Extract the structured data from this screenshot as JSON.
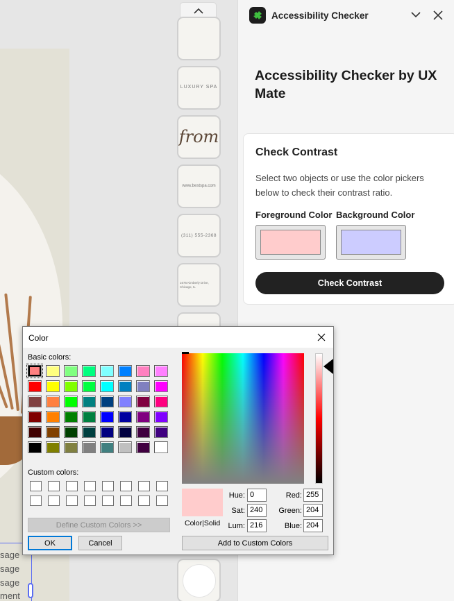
{
  "canvas": {
    "thumbnails": [
      "",
      "LUXURY SPA",
      "from",
      "www.bestspa.com",
      "(311) 555-2368",
      "1676 Kimberly Drive, Chicago, IL",
      "",
      ""
    ],
    "artboard_text": [
      "sage",
      "sage",
      "sage",
      "ment"
    ]
  },
  "panel": {
    "title": "Accessibility Checker",
    "heading": "Accessibility Checker by UX Mate",
    "card": {
      "title": "Check Contrast",
      "description": "Select two objects or use the color pickers below to check their contrast ratio.",
      "foreground_label": "Foreground Color",
      "background_label": "Background Color",
      "foreground_color": "#ffcccc",
      "background_color": "#ccccff",
      "button_label": "Check Contrast"
    }
  },
  "dialog": {
    "title": "Color",
    "basic_colors_label": "Basic colors:",
    "custom_colors_label": "Custom colors:",
    "basic_colors": [
      "#ff8080",
      "#ffff80",
      "#80ff80",
      "#00ff80",
      "#80ffff",
      "#0080ff",
      "#ff80c0",
      "#ff80ff",
      "#ff0000",
      "#ffff00",
      "#80ff00",
      "#00ff40",
      "#00ffff",
      "#0080c0",
      "#8080c0",
      "#ff00ff",
      "#804040",
      "#ff8040",
      "#00ff00",
      "#008080",
      "#004080",
      "#8080ff",
      "#800040",
      "#ff0080",
      "#800000",
      "#ff8000",
      "#008000",
      "#008040",
      "#0000ff",
      "#0000a0",
      "#800080",
      "#8000ff",
      "#400000",
      "#804000",
      "#004000",
      "#004040",
      "#000080",
      "#000040",
      "#400040",
      "#400080",
      "#000000",
      "#808000",
      "#808040",
      "#808080",
      "#408080",
      "#c0c0c0",
      "#400040",
      "#ffffff"
    ],
    "selected_basic_index": 0,
    "define_custom_label": "Define Custom Colors >>",
    "ok_label": "OK",
    "cancel_label": "Cancel",
    "preview_label": "Color|Solid",
    "preview_color": "#ffcccc",
    "hue_label": "Hue:",
    "hue": "0",
    "sat_label": "Sat:",
    "sat": "240",
    "lum_label": "Lum:",
    "lum": "216",
    "red_label": "Red:",
    "red": "255",
    "green_label": "Green:",
    "green": "204",
    "blue_label": "Blue:",
    "blue": "204",
    "add_custom_label": "Add to Custom Colors"
  }
}
